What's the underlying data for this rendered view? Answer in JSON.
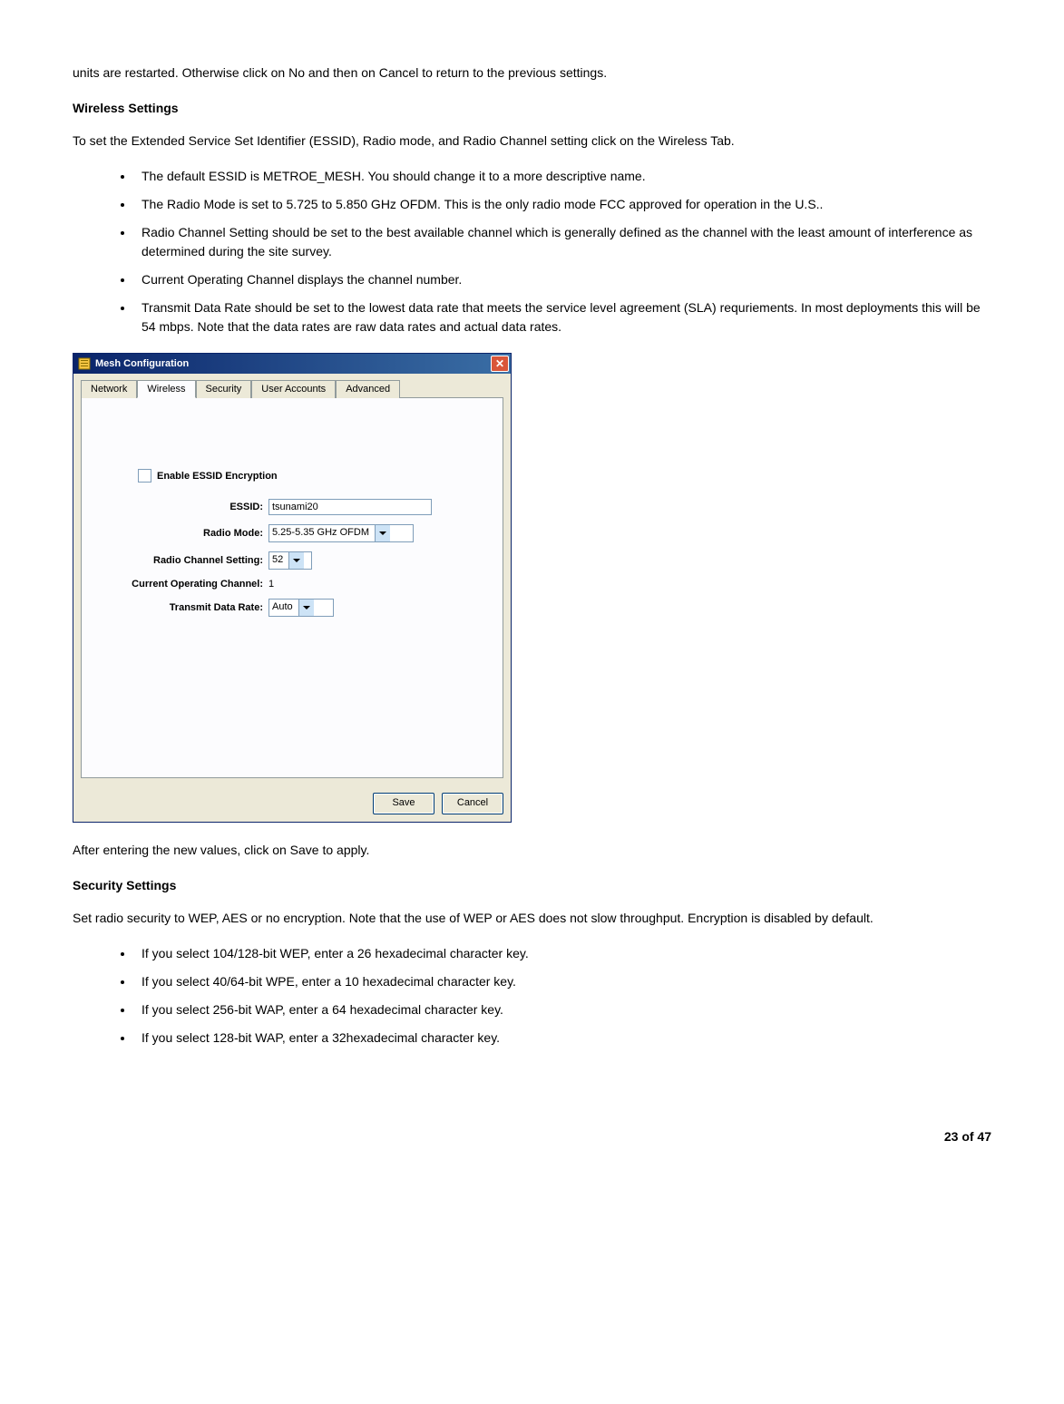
{
  "doc": {
    "intro_para": "units are restarted. Otherwise click on No and then on Cancel to return to the previous settings.",
    "wireless_heading": "Wireless Settings",
    "wireless_para": "To set the Extended Service Set Identifier (ESSID), Radio mode, and Radio Channel setting click on the Wireless Tab.",
    "wireless_bullets": [
      "The default ESSID is METROE_MESH. You should change it to a more descriptive name.",
      "The Radio Mode is set to 5.725 to 5.850 GHz OFDM. This is the only radio mode FCC approved for operation in the U.S..",
      "Radio Channel Setting should be set to the best available channel which is generally defined as the channel with the least amount of interference as determined during the site survey.",
      "Current Operating Channel displays the channel number.",
      "Transmit Data Rate should be set to the lowest data rate that meets the service level agreement (SLA) requriements. In most deployments this will be 54 mbps. Note that the data rates are raw data rates and actual data rates."
    ],
    "after_dialog_para": "After entering the new values, click on Save to apply.",
    "security_heading": "Security Settings",
    "security_para": "Set radio security to WEP, AES or no encryption. Note that the use of WEP or AES does not slow throughput.  Encryption is disabled by default.",
    "security_bullets": [
      "If you select 104/128-bit WEP, enter a 26 hexadecimal character key.",
      "If you select 40/64-bit WPE, enter a 10 hexadecimal character key.",
      "If you select 256-bit WAP, enter a 64 hexadecimal character key.",
      "If you select 128-bit WAP, enter a 32hexadecimal character key."
    ],
    "page_footer": "23 of 47"
  },
  "dialog": {
    "title": "Mesh Configuration",
    "tabs": {
      "network": "Network",
      "wireless": "Wireless",
      "security": "Security",
      "user_accounts": "User Accounts",
      "advanced": "Advanced"
    },
    "form": {
      "enable_essid_encryption_label": "Enable ESSID Encryption",
      "essid_label": "ESSID:",
      "essid_value": "tsunami20",
      "radio_mode_label": "Radio Mode:",
      "radio_mode_value": "5.25-5.35 GHz OFDM",
      "radio_channel_label": "Radio Channel Setting:",
      "radio_channel_value": "52",
      "current_channel_label": "Current Operating Channel:",
      "current_channel_value": "1",
      "transmit_rate_label": "Transmit Data Rate:",
      "transmit_rate_value": "Auto"
    },
    "buttons": {
      "save": "Save",
      "cancel": "Cancel"
    }
  }
}
